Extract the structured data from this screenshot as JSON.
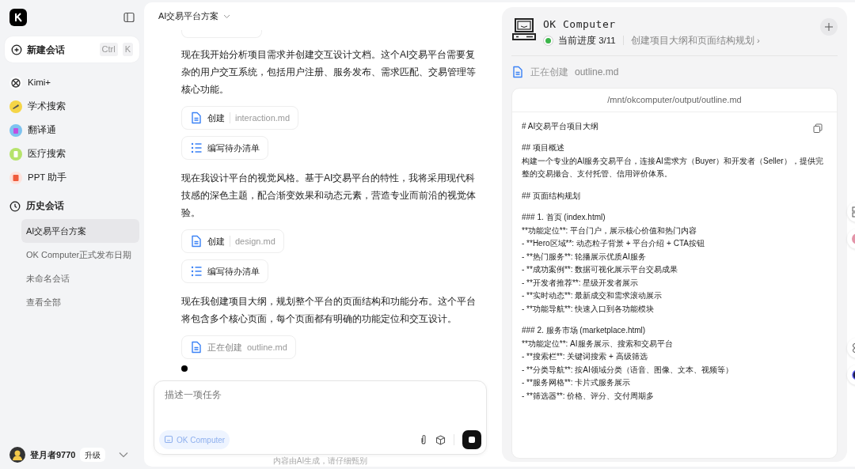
{
  "sidebar": {
    "new_chat": {
      "label": "新建会话",
      "keys": [
        "Ctrl",
        "K"
      ]
    },
    "apps": [
      {
        "label": "Kimi+",
        "kind": "kimi"
      },
      {
        "label": "学术搜索",
        "kind": "academic"
      },
      {
        "label": "翻译通",
        "kind": "translate"
      },
      {
        "label": "医疗搜索",
        "kind": "medical"
      },
      {
        "label": "PPT 助手",
        "kind": "ppt"
      }
    ],
    "history": {
      "label": "历史会话",
      "items": [
        {
          "label": "AI交易平台方案",
          "selected": true
        },
        {
          "label": "OK Computer正式发布日期",
          "selected": false
        },
        {
          "label": "未命名会话",
          "selected": false
        }
      ],
      "view_all": "查看全部"
    },
    "user": {
      "name": "登月者9770",
      "upgrade": "升级"
    }
  },
  "chat": {
    "title": "AI交易平台方案",
    "messages": [
      {
        "kind": "text",
        "text": "现在我开始分析项目需求并创建交互设计文档。这个AI交易平台需要复杂的用户交互系统，包括用户注册、服务发布、需求匹配、交易管理等核心功能。"
      },
      {
        "kind": "file",
        "action": "创建",
        "file": "interaction.md",
        "active": false
      },
      {
        "kind": "todo",
        "label": "编写待办清单"
      },
      {
        "kind": "text",
        "text": "现在我设计平台的视觉风格。基于AI交易平台的特性，我将采用现代科技感的深色主题，配合渐变效果和动态元素，营造专业而前沿的视觉体验。"
      },
      {
        "kind": "file",
        "action": "创建",
        "file": "design.md",
        "active": false
      },
      {
        "kind": "todo",
        "label": "编写待办清单"
      },
      {
        "kind": "text",
        "text": "现在我创建项目大纲，规划整个平台的页面结构和功能分布。这个平台将包含多个核心页面，每个页面都有明确的功能定位和交互设计。"
      },
      {
        "kind": "file",
        "action": "正在创建",
        "file": "outline.md",
        "active": true
      }
    ],
    "composer": {
      "placeholder": "描述一项任务",
      "mode": "OK Computer"
    },
    "disclaimer": "内容由AI生成，请仔细甄别"
  },
  "computer": {
    "title": "OK Computer",
    "progress": "当前进度 3/11",
    "step": "创建项目大纲和页面结构规划 ›",
    "status": "正在创建",
    "file": "outline.md",
    "path": "/mnt/okcomputer/output/outline.md",
    "blocks": [
      [
        "# AI交易平台项目大纲"
      ],
      [
        "## 项目概述",
        "构建一个专业的AI服务交易平台，连接AI需求方（Buyer）和开发者（Seller），提供完整的交易撮合、支付托管、信用评价体系。"
      ],
      [
        "## 页面结构规划"
      ],
      [
        "### 1. 首页 (index.html)",
        "**功能定位**: 平台门户，展示核心价值和热门内容",
        "- **Hero区域**: 动态粒子背景 + 平台介绍 + CTA按钮",
        "- **热门服务**: 轮播展示优质AI服务",
        "- **成功案例**: 数据可视化展示平台交易成果",
        "- **开发者推荐**: 星级开发者展示",
        "- **实时动态**: 最新成交和需求滚动展示",
        "- **功能导航**: 快速入口到各功能模块"
      ],
      [
        "### 2. 服务市场 (marketplace.html)",
        "**功能定位**: AI服务展示、搜索和交易平台",
        "- **搜索栏**: 关键词搜索 + 高级筛选",
        "- **分类导航**: 按AI领域分类（语音、图像、文本、视频等）",
        "- **服务网格**: 卡片式服务展示",
        "- **筛选器**: 价格、评分、交付周期多"
      ]
    ]
  }
}
